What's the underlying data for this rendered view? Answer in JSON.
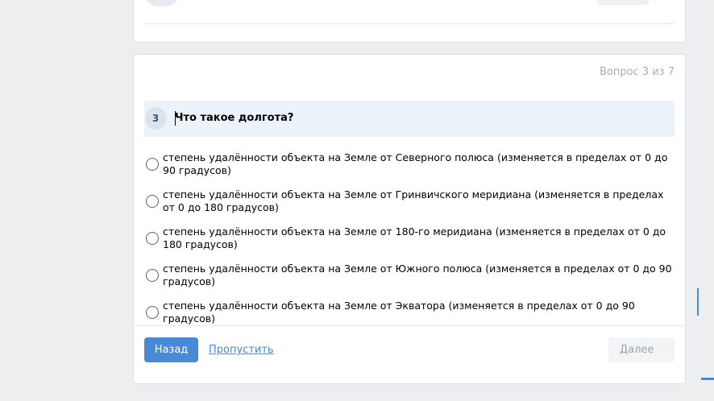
{
  "quiz": {
    "counter": "Вопрос 3 из 7",
    "question_number": "3",
    "question_text": "Что такое долгота?",
    "options": [
      {
        "text": "степень удалённости объекта на Земле от Северного полюса (изменяется в пределах от 0 до 90 градусов)"
      },
      {
        "text": "степень удалённости объекта на Земле от Гринвичского меридиана (изменяется в пределах от 0 до 180 градусов)"
      },
      {
        "text": "степень удалённости объекта на Земле от 180-го меридиана (изменяется в пределах от 0 до 180 градусов)"
      },
      {
        "text": "степень удалённости объекта на Земле от Южного полюса (изменяется в пределах от 0 до 90 градусов)"
      },
      {
        "text": "степень удалённости объекта на Земле от Экватора (изменяется в пределах от 0 до 90 градусов)"
      }
    ]
  },
  "footer": {
    "back_label": "Назад",
    "skip_label": "Пропустить",
    "next_label": "Далее",
    "next_icon": "chevron-right-icon"
  },
  "colors": {
    "accent": "#4a89d3",
    "header_bg": "#ebf2fa",
    "page_bg": "#edeef0",
    "muted_text": "#a6adb5"
  }
}
